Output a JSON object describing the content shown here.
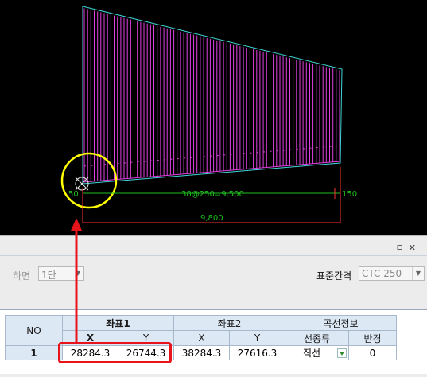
{
  "cad": {
    "dim_main": "38@250=9,500",
    "dim_left": "50",
    "dim_right": "150",
    "dim_total": "9,800",
    "colors": {
      "outline": "#3fd6d6",
      "rebar": "#e040e0",
      "dim": "#21c021",
      "marker": "#ffff00",
      "dim_red": "#ff3030"
    }
  },
  "panel": {
    "pin_label": "ㅁ",
    "close_label": "✕",
    "layer_label": "하면",
    "layer_value": "1단",
    "spacing_label": "표준간격",
    "spacing_value": "CTC 250"
  },
  "grid": {
    "no_header": "NO",
    "coord1_header": "좌표1",
    "coord2_header": "좌표2",
    "curve_header": "곡선정보",
    "x_label": "X",
    "y_label": "Y",
    "line_type_header": "선종류",
    "radius_header": "반경",
    "rows": [
      {
        "no": "1",
        "x1": "28284.3",
        "y1": "26744.3",
        "x2": "38284.3",
        "y2": "27616.3",
        "line_type": "직선",
        "radius": "0"
      }
    ]
  },
  "highlight_color": "#e8141b"
}
